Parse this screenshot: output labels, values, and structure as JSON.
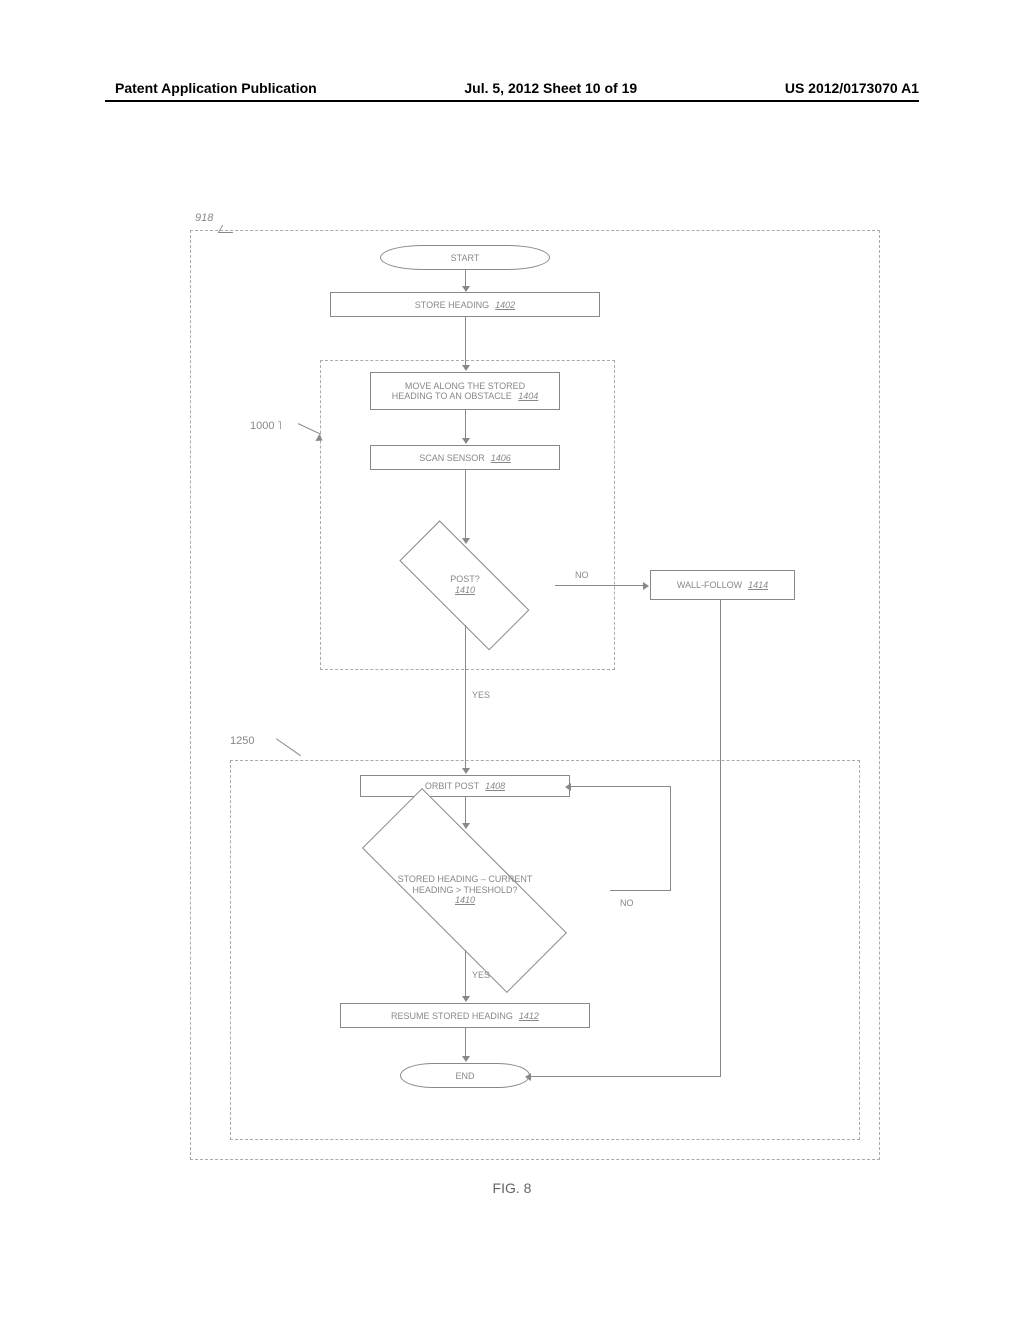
{
  "header": {
    "left": "Patent Application Publication",
    "center": "Jul. 5, 2012   Sheet 10 of 19",
    "right": "US 2012/0173070 A1"
  },
  "refs": {
    "r918": "918",
    "r1000": "1000",
    "r1250": "1250"
  },
  "nodes": {
    "start": "START",
    "store_heading": {
      "text": "STORE HEADING",
      "ref": "1402"
    },
    "move_along": {
      "line1": "MOVE ALONG THE STORED",
      "line2": "HEADING TO AN OBSTACLE",
      "ref": "1404"
    },
    "scan_sensor": {
      "text": "SCAN SENSOR",
      "ref": "1406"
    },
    "post_q": {
      "text": "POST?",
      "ref": "1410"
    },
    "wall_follow": {
      "text": "WALL-FOLLOW",
      "ref": "1414"
    },
    "orbit_post": {
      "text": "ORBIT POST",
      "ref": "1408"
    },
    "threshold_q": {
      "line1": "STORED HEADING – CURRENT",
      "line2": "HEADING > THESHOLD?",
      "ref": "1410"
    },
    "resume": {
      "text": "RESUME STORED HEADING",
      "ref": "1412"
    },
    "end": "END"
  },
  "edges": {
    "yes": "YES",
    "no": "NO"
  },
  "figure_caption": "FIG. 8"
}
